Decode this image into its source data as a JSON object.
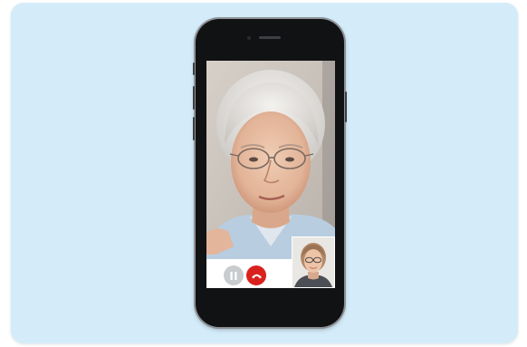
{
  "scene": {
    "panel_color": "#d4ecfa",
    "device": "smartphone",
    "frame_color": "#111214"
  },
  "call": {
    "caller_video": "elderly-woman-portrait",
    "self_view": "young-woman-with-glasses-portrait",
    "controls": [
      {
        "icon": "pause-icon",
        "color": "#c9cccf"
      },
      {
        "icon": "end-call-icon",
        "color": "#d9221e"
      }
    ]
  }
}
